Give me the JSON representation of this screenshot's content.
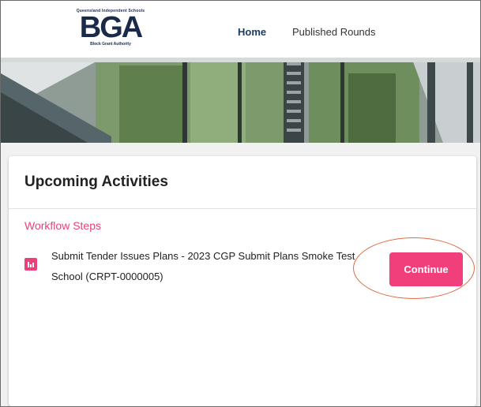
{
  "header": {
    "logo": {
      "top_text": "Queensland Independent Schools",
      "mark": "BGA",
      "bottom_text": "Block Grant Authority"
    },
    "nav": {
      "home_label": "Home",
      "rounds_label": "Published Rounds"
    }
  },
  "card": {
    "title": "Upcoming Activities",
    "section_label": "Workflow Steps",
    "steps": [
      {
        "icon": "bar-chart-icon",
        "text": "Submit Tender Issues Plans - 2023 CGP Submit Plans Smoke Test School (CRPT-0000005)",
        "action_label": "Continue"
      }
    ]
  },
  "colors": {
    "accent_pink": "#f03f7b",
    "section_pink": "#e8417b",
    "nav_active": "#1b3a5c",
    "annotation_ring": "#e06a46"
  }
}
